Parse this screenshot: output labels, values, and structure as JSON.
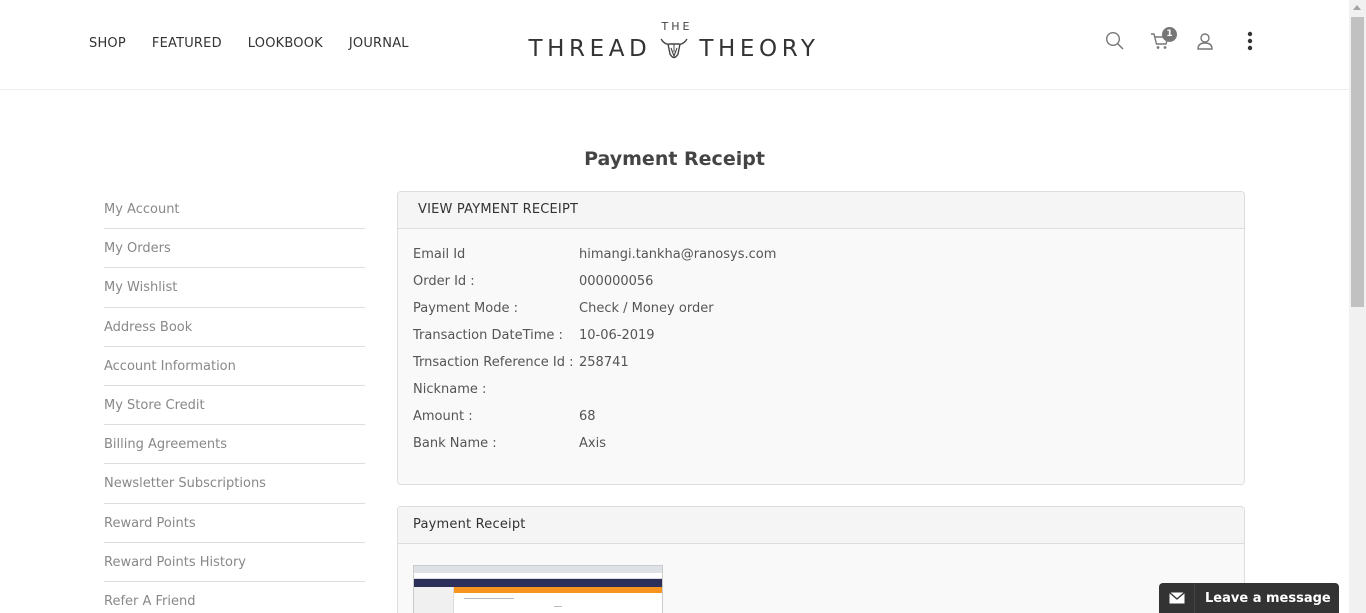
{
  "header": {
    "nav": [
      "SHOP",
      "FEATURED",
      "LOOKBOOK",
      "JOURNAL"
    ],
    "logo_top": "THE",
    "logo_left": "THREAD",
    "logo_right": "THEORY",
    "cart_count": "1"
  },
  "page_title": "Payment Receipt",
  "sidebar": {
    "items": [
      "My Account",
      "My Orders",
      "My Wishlist",
      "Address Book",
      "Account Information",
      "My Store Credit",
      "Billing Agreements",
      "Newsletter Subscriptions",
      "Reward Points",
      "Reward Points History",
      "Refer A Friend"
    ]
  },
  "receipt": {
    "heading": "VIEW PAYMENT RECEIPT",
    "rows": [
      {
        "label": "Email Id",
        "value": "himangi.tankha@ranosys.com"
      },
      {
        "label": "Order Id :",
        "value": "000000056"
      },
      {
        "label": "Payment Mode :",
        "value": "Check / Money order"
      },
      {
        "label": "Transaction DateTime :",
        "value": "10-06-2019"
      },
      {
        "label": "Trnsaction Reference Id :",
        "value": "258741"
      },
      {
        "label": "Nickname :",
        "value": ""
      },
      {
        "label": "Amount :",
        "value": "68"
      },
      {
        "label": "Bank Name :",
        "value": "Axis"
      }
    ]
  },
  "receipt_image": {
    "heading": "Payment Receipt"
  },
  "chat": {
    "label": "Leave a message"
  },
  "icons": {
    "search": "search-icon",
    "cart": "cart-icon",
    "user": "user-icon",
    "more": "more-vertical-icon",
    "chat": "envelope-icon"
  }
}
